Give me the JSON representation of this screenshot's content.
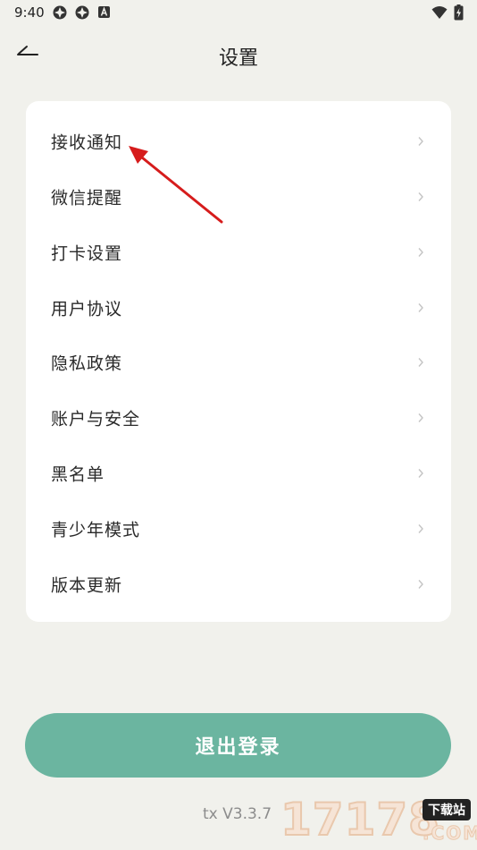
{
  "status_bar": {
    "time": "9:40",
    "icons_left": [
      "app-icon-1",
      "app-icon-2",
      "text-a-icon"
    ],
    "icons_right": [
      "wifi-icon",
      "battery-charging-icon"
    ]
  },
  "nav": {
    "back_icon": "back-arrow-icon",
    "title": "设置"
  },
  "menu": {
    "items": [
      {
        "label": "接收通知",
        "name": "receive-notifications"
      },
      {
        "label": "微信提醒",
        "name": "wechat-reminder"
      },
      {
        "label": "打卡设置",
        "name": "checkin-settings"
      },
      {
        "label": "用户协议",
        "name": "user-agreement"
      },
      {
        "label": "隐私政策",
        "name": "privacy-policy"
      },
      {
        "label": "账户与安全",
        "name": "account-security"
      },
      {
        "label": "黑名单",
        "name": "blacklist"
      },
      {
        "label": "青少年模式",
        "name": "teen-mode"
      },
      {
        "label": "版本更新",
        "name": "version-update"
      }
    ]
  },
  "logout": {
    "label": "退出登录"
  },
  "version": "tx V3.3.7",
  "watermark": {
    "digits": "17178",
    "tag": "下载站",
    "suffix": ".COM"
  },
  "colors": {
    "background": "#f1f1ec",
    "card": "#ffffff",
    "accent": "#6bb5a0",
    "arrow": "#d61c1c"
  }
}
